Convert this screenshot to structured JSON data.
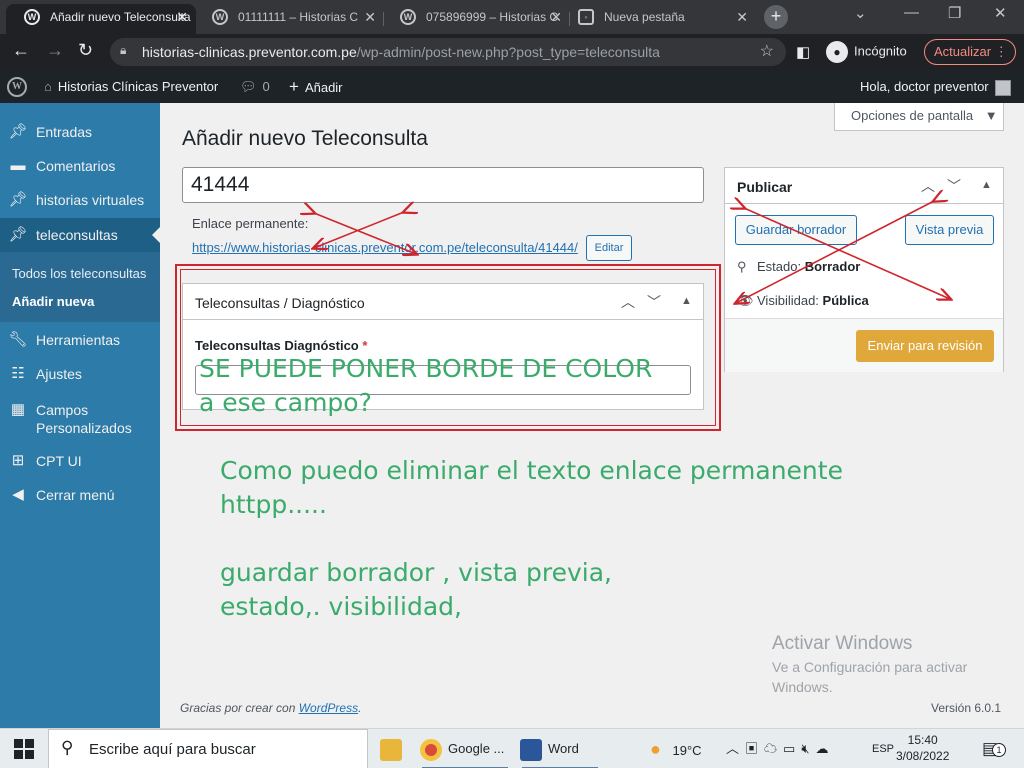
{
  "browser": {
    "tabs": [
      {
        "title": "Añadir nuevo Teleconsulta",
        "icon": "wordpress-icon"
      },
      {
        "title": "01111111 – Historias C",
        "icon": "wordpress-icon"
      },
      {
        "title": "075896999 – Historias C",
        "icon": "wordpress-icon"
      },
      {
        "title": "Nueva pestaña",
        "icon": "globe-icon"
      }
    ],
    "url_host": "historias-clinicas.preventor.com.pe",
    "url_path": "/wp-admin/post-new.php?post_type=teleconsulta",
    "incognito_label": "Incógnito",
    "update_label": "Actualizar"
  },
  "adminbar": {
    "site_name": "Historias Clínicas Preventor",
    "comments_count": "0",
    "add_new": "Añadir",
    "greeting": "Hola, doctor preventor"
  },
  "sidebar": {
    "items": [
      {
        "label": "Entradas",
        "icon": "pin-icon"
      },
      {
        "label": "Comentarios",
        "icon": "comment-icon"
      },
      {
        "label": "historias virtuales",
        "icon": "pin-icon"
      },
      {
        "label": "teleconsultas",
        "icon": "pin-icon"
      },
      {
        "label": "Herramientas",
        "icon": "wrench-icon"
      },
      {
        "label": "Ajustes",
        "icon": "sliders-icon"
      },
      {
        "label": "Campos Personalizados",
        "icon": "grid-icon"
      },
      {
        "label": "CPT UI",
        "icon": "qr-icon"
      },
      {
        "label": "Cerrar menú",
        "icon": "collapse-icon"
      }
    ],
    "submenu": [
      "Todos los teleconsultas",
      "Añadir nueva"
    ]
  },
  "screen_options": "Opciones de pantalla",
  "page_title": "Añadir nuevo Teleconsulta",
  "post_title_value": "41444",
  "permalink": {
    "label": "Enlace permanente:",
    "url": "https://www.historias-clinicas.preventor.com.pe/teleconsulta/41444/",
    "edit": "Editar"
  },
  "metabox": {
    "title": "Teleconsultas / Diagnóstico",
    "field_label": "Teleconsultas Diagnóstico",
    "required_mark": "*"
  },
  "publish": {
    "title": "Publicar",
    "save_draft": "Guardar borrador",
    "preview": "Vista previa",
    "status_label": "Estado:",
    "status_value": "Borrador",
    "visibility_label": "Visibilidad:",
    "visibility_value": "Pública",
    "submit": "Enviar para revisión"
  },
  "annotations": {
    "note1_line1": "SE PUEDE PONER BORDE DE COLOR",
    "note1_line2": "a ese campo?",
    "note2_line1": "Como puedo eliminar el texto enlace permanente",
    "note2_line2": "httpp.....",
    "note3_line1": "guardar borrador , vista previa,",
    "note3_line2": "estado,. visibilidad,"
  },
  "footer": {
    "thanks_prefix": "Gracias por crear con ",
    "wordpress_link": "WordPress",
    "thanks_suffix": ".",
    "version": "Versión 6.0.1"
  },
  "watermark": {
    "title": "Activar Windows",
    "line1": "Ve a Configuración para activar",
    "line2": "Windows."
  },
  "taskbar": {
    "search_placeholder": "Escribe aquí para buscar",
    "apps": [
      {
        "label": "",
        "icon": "file-explorer-icon"
      },
      {
        "label": "Google ...",
        "icon": "chrome-icon"
      },
      {
        "label": "Word",
        "icon": "word-icon"
      }
    ],
    "weather": "19°C",
    "language": "ESP",
    "time": "15:40",
    "date": "3/08/2022",
    "notification_count": "1"
  },
  "colors": {
    "sidebar": "#2c7ba8",
    "adminbar": "#1d2327",
    "annotation": "#3aab6b",
    "markup_red": "#d0252d",
    "submit": "#e0a83a"
  }
}
